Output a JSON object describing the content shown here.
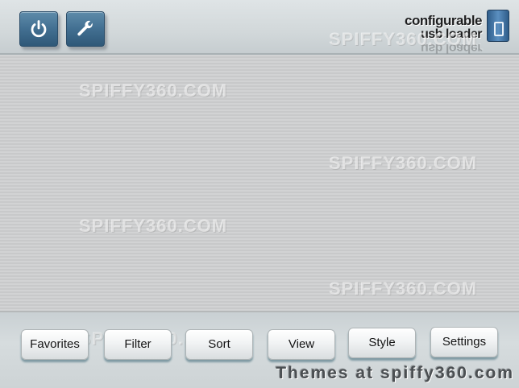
{
  "header": {
    "logo": {
      "line1": "configurable",
      "line2": "usb loader",
      "line3": "usb loader"
    },
    "buttons": [
      {
        "name": "power-button",
        "icon": "power-icon"
      },
      {
        "name": "settings-tool-button",
        "icon": "wrench-icon"
      }
    ]
  },
  "watermarks": [
    "SPIFFY360.COM",
    "SPIFFY360.COM",
    "SPIFFY360.COM",
    "SPIFFY360.COM",
    "SPIFFY360.COM",
    "SPIFFY360.COM"
  ],
  "nav": {
    "favorites": "Favorites",
    "filter": "Filter",
    "sort": "Sort",
    "view": "View",
    "style": "Style",
    "settings": "Settings"
  },
  "footer": {
    "text": "Themes at spiffy360.com"
  },
  "colors": {
    "button_blue": "#426f91",
    "background_gray": "#cfd1d2"
  }
}
